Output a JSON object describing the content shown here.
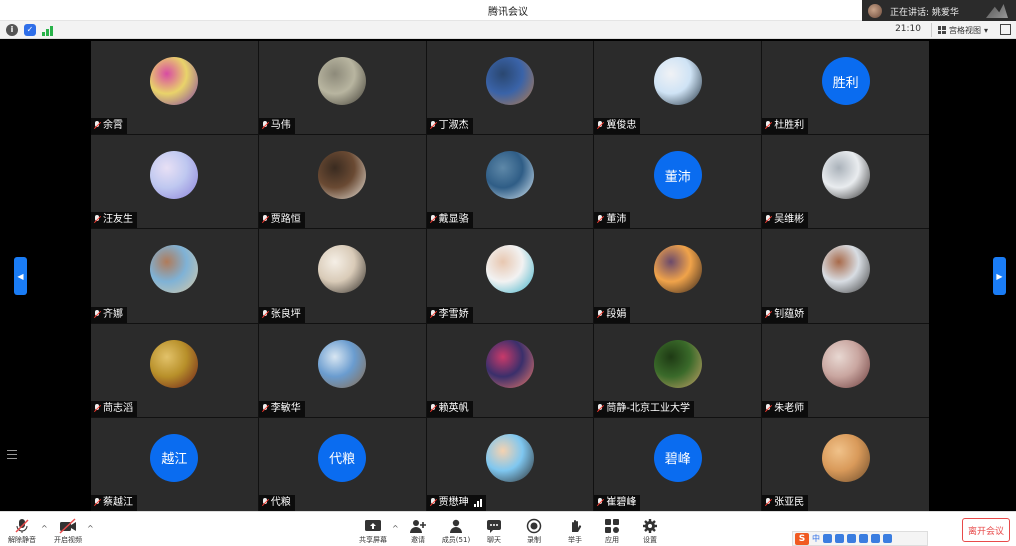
{
  "window": {
    "title": "腾讯会议"
  },
  "speaking": {
    "label": "正在讲话: 姚爱华"
  },
  "infobar": {
    "time": "21:10",
    "view_label": "宫格视图",
    "view_caret": "▾"
  },
  "participants": [
    {
      "name": "余霄",
      "avatar": "photo",
      "colors": [
        "#e9d36a",
        "#7d3fa6",
        "#d84ca2"
      ]
    },
    {
      "name": "马伟",
      "avatar": "photo",
      "colors": [
        "#b8b5a0",
        "#3e3b33",
        "#8d8a7a"
      ]
    },
    {
      "name": "丁淑杰",
      "avatar": "photo",
      "colors": [
        "#3a63a8",
        "#b77b4a",
        "#2a4770"
      ]
    },
    {
      "name": "冀俊忠",
      "avatar": "photo",
      "colors": [
        "#cfe3f5",
        "#1e2e3c",
        "#f0f2f5"
      ]
    },
    {
      "name": "杜胜利",
      "avatar": "text",
      "initials": "胜利"
    },
    {
      "name": "汪友生",
      "avatar": "photo",
      "colors": [
        "#bfc8f0",
        "#8a7fd9",
        "#e8e0f5"
      ]
    },
    {
      "name": "贾路恒",
      "avatar": "photo",
      "colors": [
        "#6a4a33",
        "#e8e2d9",
        "#3a2b20"
      ]
    },
    {
      "name": "戴显骆",
      "avatar": "photo",
      "colors": [
        "#2f5d86",
        "#d8e9f3",
        "#5e88a8"
      ]
    },
    {
      "name": "董沛",
      "avatar": "text",
      "initials": "董沛"
    },
    {
      "name": "吴维彬",
      "avatar": "photo",
      "colors": [
        "#e9ecef",
        "#2b2b2b",
        "#aab2ba"
      ]
    },
    {
      "name": "齐娜",
      "avatar": "photo",
      "colors": [
        "#7fb2d6",
        "#d8c9a6",
        "#b07b5a"
      ]
    },
    {
      "name": "张良坪",
      "avatar": "photo",
      "colors": [
        "#d9cbb8",
        "#2e2a26",
        "#f5efe6"
      ]
    },
    {
      "name": "李雪娇",
      "avatar": "photo",
      "colors": [
        "#f2f2f2",
        "#3ab0c7",
        "#e8c7b0"
      ]
    },
    {
      "name": "段娟",
      "avatar": "photo",
      "colors": [
        "#f0a34a",
        "#2a1e1a",
        "#6b4a6b"
      ]
    },
    {
      "name": "钊蕴娇",
      "avatar": "photo",
      "colors": [
        "#d8dde3",
        "#3a3a3a",
        "#a86a4a"
      ]
    },
    {
      "name": "茼志滔",
      "avatar": "photo",
      "colors": [
        "#b8902a",
        "#6a1a1a",
        "#e2c26a"
      ]
    },
    {
      "name": "李敏华",
      "avatar": "photo",
      "colors": [
        "#6a9ccf",
        "#8a6a4a",
        "#d8e6f2"
      ]
    },
    {
      "name": "赖英帆",
      "avatar": "photo",
      "colors": [
        "#3a2f6b",
        "#f07a6a",
        "#c93a6a"
      ]
    },
    {
      "name": "茼静-北京工业大学",
      "avatar": "photo",
      "colors": [
        "#3a6a2a",
        "#c9a46a",
        "#1e3a14"
      ]
    },
    {
      "name": "朱老师",
      "avatar": "photo",
      "colors": [
        "#c9a6a0",
        "#6a3a3a",
        "#e8d8d2"
      ]
    },
    {
      "name": "蔡越江",
      "avatar": "text",
      "initials": "越江"
    },
    {
      "name": "代粮",
      "avatar": "text",
      "initials": "代粮"
    },
    {
      "name": "贾懋珅",
      "avatar": "cartoon",
      "colors": [
        "#7fc7f0",
        "#2a2a2a",
        "#f5d2b0"
      ],
      "speaking": true
    },
    {
      "name": "崔碧峰",
      "avatar": "text",
      "initials": "碧峰"
    },
    {
      "name": "张亚民",
      "avatar": "photo",
      "colors": [
        "#d99a5a",
        "#6a4a2a",
        "#f0c28a"
      ]
    }
  ],
  "toolbar": {
    "unmute_label": "解除静音",
    "video_label": "开启视频",
    "share_label": "共享屏幕",
    "invite_label": "邀请",
    "members_label": "成员(51)",
    "chat_label": "聊天",
    "record_label": "录制",
    "raise_label": "举手",
    "apps_label": "应用",
    "settings_label": "设置",
    "leave_label": "离开会议",
    "ime_lang": "中"
  },
  "colors": {
    "accent": "#0a6cf0",
    "leave": "#e84a4a"
  }
}
